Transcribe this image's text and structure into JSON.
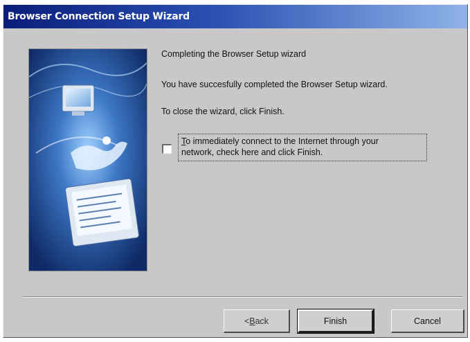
{
  "window": {
    "title": "Browser Connection Setup Wizard"
  },
  "image": {
    "alt": "wizard-illustration"
  },
  "content": {
    "heading": "Completing the Browser Setup wizard",
    "success": "You have succesfully completed the Browser Setup wizard.",
    "close_hint": "To close the wizard, click Finish."
  },
  "checkbox": {
    "checked": false,
    "label_accel": "T",
    "label_line1_rest": "o immediately connect to the Internet through your",
    "label_line2": "network, check here and click Finish."
  },
  "buttons": {
    "back_prefix": "< ",
    "back_accel": "B",
    "back_rest": "ack",
    "finish": "Finish",
    "cancel": "Cancel"
  },
  "colors": {
    "title_gradient_start": "#0a1e7a",
    "title_gradient_end": "#8fb3e8",
    "dialog_face": "#c8c8c8",
    "image_background": "#1a3f86"
  },
  "icons": {
    "wizard_image": "computer-monitor-hand-illustration"
  }
}
